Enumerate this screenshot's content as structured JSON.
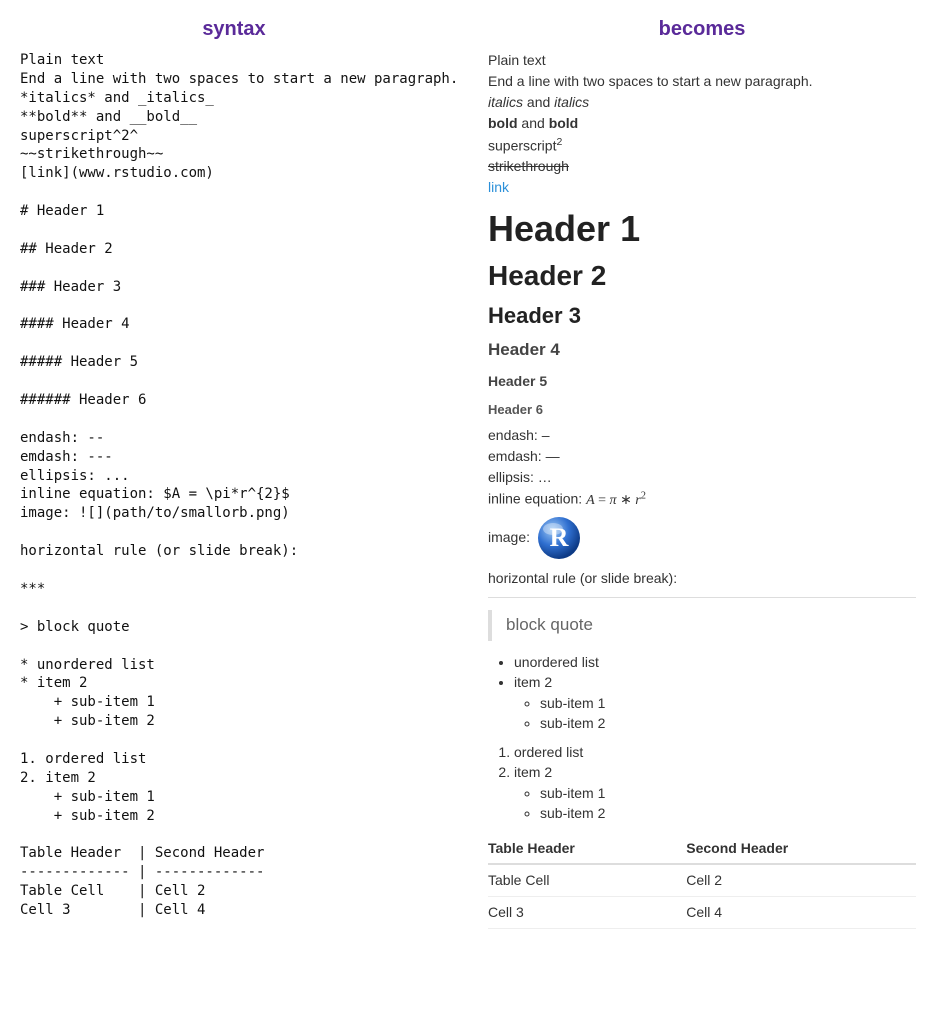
{
  "headers": {
    "syntax": "syntax",
    "becomes": "becomes"
  },
  "syntax_text": "Plain text\nEnd a line with two spaces to start a new paragraph.\n*italics* and _italics_\n**bold** and __bold__\nsuperscript^2^\n~~strikethrough~~\n[link](www.rstudio.com)\n\n# Header 1\n\n## Header 2\n\n### Header 3\n\n#### Header 4\n\n##### Header 5\n\n###### Header 6\n\nendash: --\nemdash: ---\nellipsis: ...\ninline equation: $A = \\pi*r^{2}$\nimage: ![](path/to/smallorb.png)\n\nhorizontal rule (or slide break):\n\n***\n\n> block quote\n\n* unordered list\n* item 2\n    + sub-item 1\n    + sub-item 2\n\n1. ordered list\n2. item 2\n    + sub-item 1\n    + sub-item 2\n\nTable Header  | Second Header\n------------- | -------------\nTable Cell    | Cell 2\nCell 3        | Cell 4",
  "rendered": {
    "plain1": "Plain text",
    "plain2": "End a line with two spaces to start a new paragraph.",
    "italics": "italics",
    "and": " and ",
    "bold": "bold",
    "super_prefix": "superscript",
    "super_exp": "2",
    "strike": "strikethrough",
    "link": "link",
    "h1": "Header 1",
    "h2": "Header 2",
    "h3": "Header 3",
    "h4": "Header 4",
    "h5": "Header 5",
    "h6": "Header 6",
    "endash": "endash: –",
    "emdash": "emdash: —",
    "ellipsis": "ellipsis: …",
    "eq_prefix": "inline equation: ",
    "eq_A": "A",
    "eq_eq": " = ",
    "eq_pi": "π",
    "eq_star": " ∗ ",
    "eq_r": "r",
    "eq_exp": "2",
    "image_label": "image:",
    "hr_label": "horizontal rule (or slide break):",
    "blockquote": "block quote",
    "ul": [
      "unordered list",
      "item 2"
    ],
    "ul_sub": [
      "sub-item 1",
      "sub-item 2"
    ],
    "ol": [
      "ordered list",
      "item 2"
    ],
    "ol_sub": [
      "sub-item 1",
      "sub-item 2"
    ],
    "table": {
      "headers": [
        "Table Header",
        "Second Header"
      ],
      "rows": [
        [
          "Table Cell",
          "Cell 2"
        ],
        [
          "Cell 3",
          "Cell 4"
        ]
      ]
    }
  }
}
